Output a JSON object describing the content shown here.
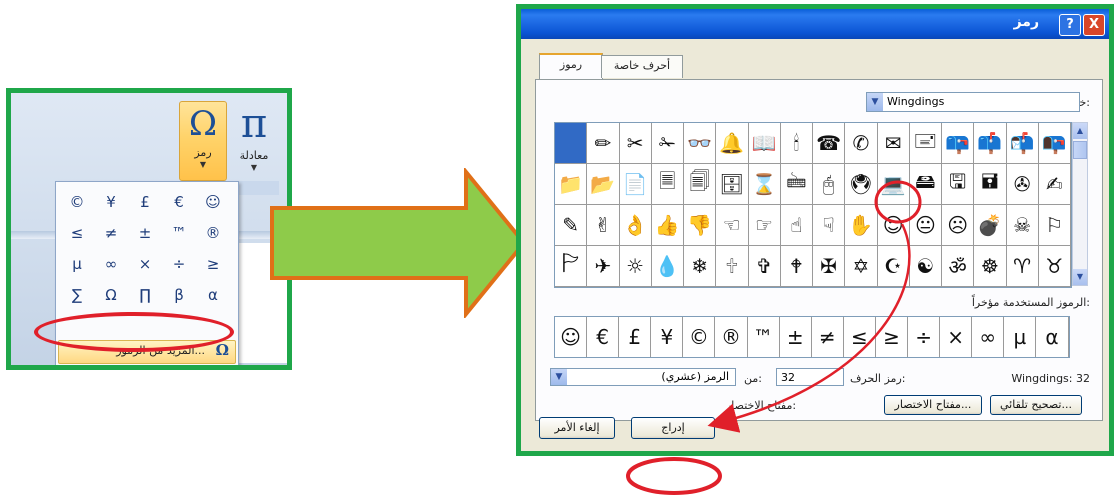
{
  "ribbon": {
    "symbol_glyph": "Ω",
    "symbol_label": "رمز",
    "equation_glyph": "π",
    "equation_label": "معادلة",
    "group_label": "رمـ",
    "dropdown_arrow": "▼"
  },
  "symbols_menu": {
    "items": [
      "©",
      "¥",
      "£",
      "€",
      "☺",
      "≤",
      "≠",
      "±",
      "™",
      "®",
      "µ",
      "∞",
      "×",
      "÷",
      "≥",
      "∑",
      "Ω",
      "∏",
      "β",
      "α"
    ],
    "more_label": "المزيد من الرموز...",
    "more_glyph": "Ω"
  },
  "dialog": {
    "title": "رمز",
    "help": "?",
    "close": "X",
    "tabs": [
      "رموز",
      "أحرف خاصة"
    ],
    "font_label": "خط:",
    "font_value": "Wingdings",
    "glyph_grid": [
      [
        "█",
        "✏",
        "✂",
        "✁",
        "👓",
        "🔔",
        "📖",
        "🕯",
        "☎",
        "✆",
        "✉",
        "🖃",
        "📪",
        "📫",
        "📬",
        "📭"
      ],
      [
        "📁",
        "📂",
        "📄",
        "🗏",
        "🗐",
        "🗄",
        "⌛",
        "🖮",
        "🖰",
        "🖲",
        "💻",
        "🖴",
        "🖫",
        "🖬",
        "✇",
        "✍"
      ],
      [
        "✎",
        "✌",
        "👌",
        "👍",
        "👎",
        "☜",
        "☞",
        "☝",
        "☟",
        "✋",
        "☺",
        "😐",
        "☹",
        "💣",
        "☠",
        "⚐"
      ],
      [
        "🏱",
        "✈",
        "☼",
        "💧",
        "❄",
        "🕆",
        "✞",
        "🕈",
        "✠",
        "✡",
        "☪",
        "☯",
        "ॐ",
        "☸",
        "♈",
        "♉"
      ]
    ],
    "selected_cell": 0,
    "recent_label": "الرموز المستخدمة مؤخراً:",
    "recent": [
      "☺",
      "€",
      "£",
      "¥",
      "©",
      "®",
      "™",
      "±",
      "≠",
      "≤",
      "≥",
      "÷",
      "×",
      "∞",
      "µ",
      "α"
    ],
    "char_code_label": "رمز الحرف:",
    "char_code_value": "32",
    "from_label": "من:",
    "from_value": "الرمز (عشري)",
    "font_code": "Wingdings: 32",
    "autocorrect_button": "تصحيح تلقائي...",
    "shortcut_button": "مفتاح الاختصار...",
    "shortcut_label": "مفتاح الاختصار:",
    "insert_button": "إدراج",
    "cancel_button": "إلغاء الأمر"
  },
  "colors": {
    "frame_green": "#1fa74a",
    "highlight_red": "#e0202a",
    "arrow_fill": "#8ecb4a",
    "arrow_stroke": "#e07018",
    "selection_blue": "#316ac5"
  }
}
